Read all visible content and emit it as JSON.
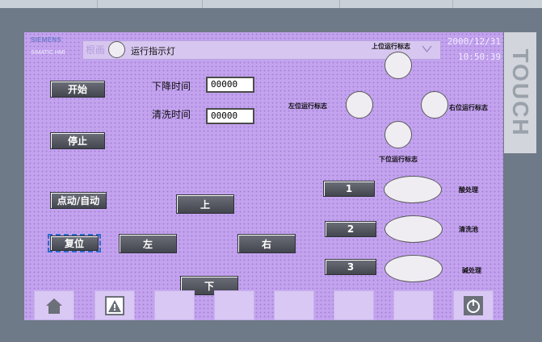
{
  "brand": {
    "line1": "SIEMENS",
    "line2": "SIMATIC HMI"
  },
  "header": {
    "ghost_text": "根画",
    "indicator_label": "运行指示灯",
    "top_flag_label": "上位运行标志",
    "date": "2000/12/31",
    "time": "10:50:39"
  },
  "flags": {
    "left": "左位运行标志",
    "right": "右位运行标志",
    "bottom": "下位运行标志"
  },
  "buttons": {
    "start": "开始",
    "stop": "停止",
    "jog_auto": "点动/自动",
    "reset": "复位",
    "up": "上",
    "left": "左",
    "right": "右",
    "down": "下",
    "num1": "1",
    "num2": "2",
    "num3": "3"
  },
  "fields": {
    "fall_time_label": "下降时间",
    "fall_time_value": "00000",
    "wash_time_label": "清洗时间",
    "wash_time_value": "00000"
  },
  "tanks": {
    "acid": "酸处理",
    "wash": "清洗池",
    "alkali": "碱处理"
  },
  "bezel": {
    "touch": "TOUCH"
  },
  "icons": {
    "home": "home-icon",
    "alarm": "alarm-icon",
    "power": "power-icon"
  }
}
